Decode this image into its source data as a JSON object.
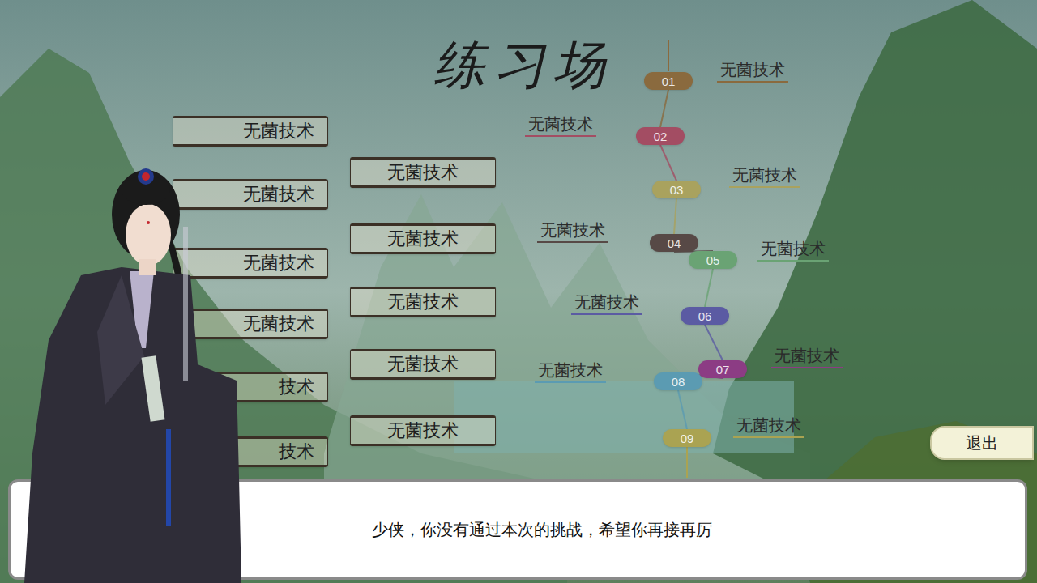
{
  "title": "练习场",
  "left_column": [
    {
      "label": "无菌技术"
    },
    {
      "label": "无菌技术"
    },
    {
      "label": "无菌技术"
    },
    {
      "label": "无菌技术"
    },
    {
      "label": "技术"
    },
    {
      "label": "技术"
    }
  ],
  "middle_column": [
    {
      "label": "无菌技术"
    },
    {
      "label": "无菌技术"
    },
    {
      "label": "无菌技术"
    },
    {
      "label": "无菌技术"
    },
    {
      "label": "无菌技术"
    }
  ],
  "timeline": [
    {
      "number": "01",
      "label": "无菌技术",
      "color": "#8a6a3e"
    },
    {
      "number": "02",
      "label": "无菌技术",
      "color": "#a34d63"
    },
    {
      "number": "03",
      "label": "无菌技术",
      "color": "#a9a25e"
    },
    {
      "number": "04",
      "label": "无菌技术",
      "color": "#574946"
    },
    {
      "number": "05",
      "label": "无菌技术",
      "color": "#6aa374"
    },
    {
      "number": "06",
      "label": "无菌技术",
      "color": "#5b5ba3"
    },
    {
      "number": "07",
      "label": "无菌技术",
      "color": "#8c3c84"
    },
    {
      "number": "08",
      "label": "无菌技术",
      "color": "#5b9bb2"
    },
    {
      "number": "09",
      "label": "无菌技术",
      "color": "#aaa352"
    }
  ],
  "exit_button": "退出",
  "dialog": {
    "text": "少侠，你没有通过本次的挑战，希望你再接再厉"
  }
}
